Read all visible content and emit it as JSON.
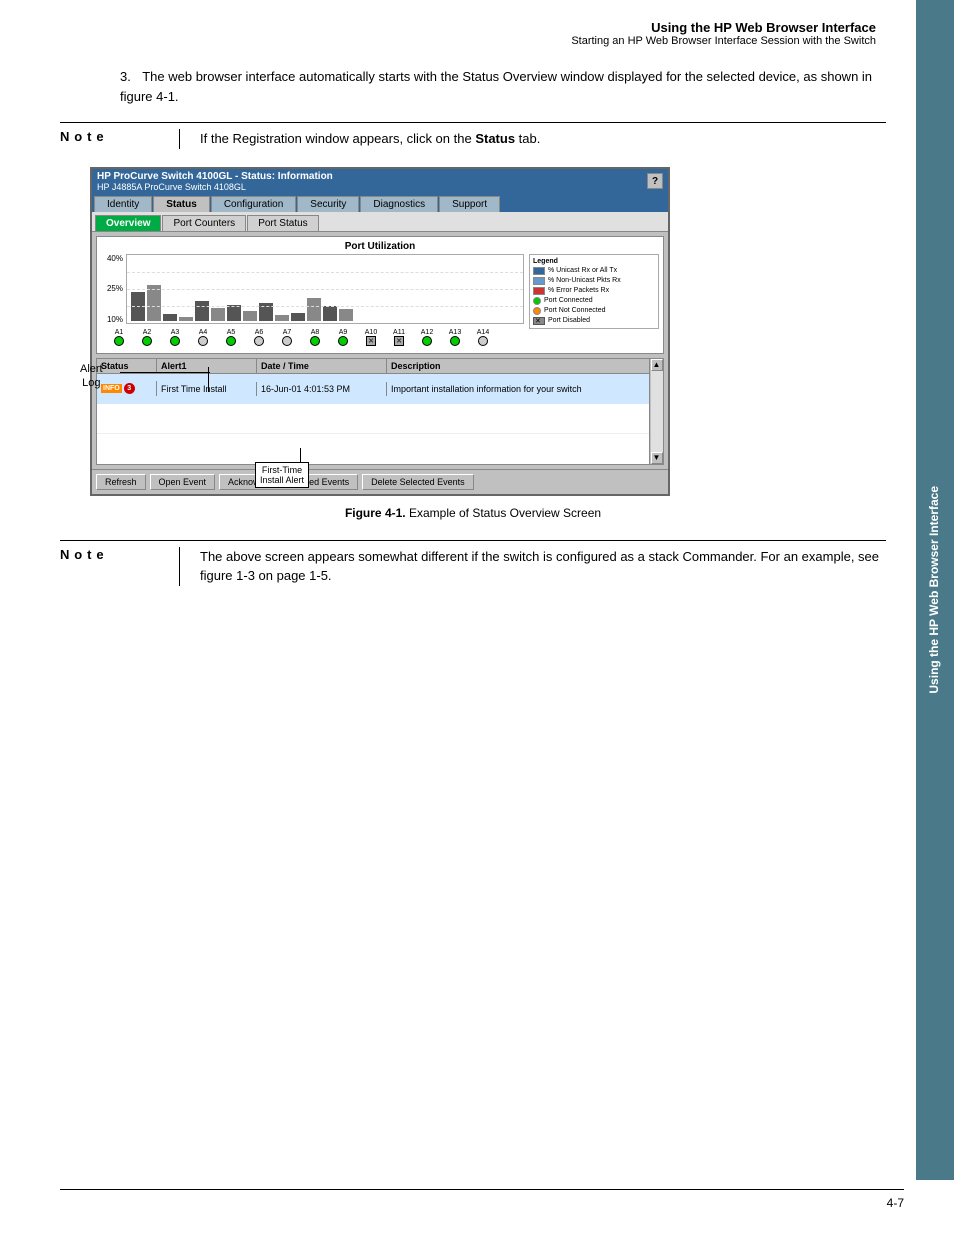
{
  "page": {
    "header": {
      "title": "Using the HP Web Browser Interface",
      "subtitle": "Starting an HP Web Browser Interface Session with the Switch"
    },
    "sidebar": {
      "text": "Using the HP Web Browser Interface"
    },
    "step3": {
      "number": "3.",
      "text": "The web browser interface automatically starts with the Status Overview window displayed for the selected device, as shown in figure 4-1."
    },
    "note1": {
      "label": "N o t e",
      "text_before": "If the Registration window appears, click on the ",
      "bold_text": "Status",
      "text_after": " tab."
    },
    "switch_ui": {
      "titlebar": {
        "title": "HP ProCurve Switch 4100GL - Status: Information",
        "subtitle": "HP J4885A ProCurve Switch 4108GL",
        "help_label": "?"
      },
      "nav_tabs": [
        {
          "label": "Identity",
          "active": false
        },
        {
          "label": "Status",
          "active": true
        },
        {
          "label": "Configuration",
          "active": false
        },
        {
          "label": "Security",
          "active": false
        },
        {
          "label": "Diagnostics",
          "active": false
        },
        {
          "label": "Support",
          "active": false
        }
      ],
      "subnav_tabs": [
        {
          "label": "Overview",
          "active": true
        },
        {
          "label": "Port Counters",
          "active": false
        },
        {
          "label": "Port Status",
          "active": false
        }
      ],
      "chart": {
        "title": "Port Utilization",
        "y_labels": [
          "40%",
          "25%",
          "10%"
        ],
        "legend": [
          {
            "color": "#336699",
            "text": "% Unicast Rx or All Tx"
          },
          {
            "color": "#336699",
            "text": "% Non-Unicast Pkts Rx"
          },
          {
            "color": "#cc3333",
            "text": "% Error Packets Rx"
          },
          {
            "type": "dot",
            "color": "#00cc00",
            "text": "Port Connected"
          },
          {
            "type": "dot",
            "color": "#ff8800",
            "text": "Port Not Connected"
          },
          {
            "type": "cross",
            "text": "Port Disabled"
          }
        ]
      },
      "ports": [
        {
          "label": "A1",
          "status": "green"
        },
        {
          "label": "A2",
          "status": "green"
        },
        {
          "label": "A3",
          "status": "green"
        },
        {
          "label": "A4",
          "status": "gray"
        },
        {
          "label": "A5",
          "status": "green"
        },
        {
          "label": "A6",
          "status": "gray"
        },
        {
          "label": "A7",
          "status": "gray"
        },
        {
          "label": "A8",
          "status": "green"
        },
        {
          "label": "A9",
          "status": "green"
        },
        {
          "label": "A10",
          "status": "crossed"
        },
        {
          "label": "A11",
          "status": "crossed"
        },
        {
          "label": "A12",
          "status": "green"
        },
        {
          "label": "A13",
          "status": "green"
        },
        {
          "label": "A14",
          "status": "gray"
        }
      ],
      "alert_table": {
        "headers": [
          "Status",
          "Alert1",
          "Date / Time",
          "Description"
        ],
        "row": {
          "status_badge": "INFO",
          "status_num": "3",
          "alert": "First Time Install",
          "datetime": "16-Jun-01 4:01:53 PM",
          "description": "Important installation information for your switch"
        }
      },
      "buttons": [
        {
          "label": "Refresh"
        },
        {
          "label": "Open Event"
        },
        {
          "label": "Acknowledge Selected Events"
        },
        {
          "label": "Delete Selected Events"
        }
      ]
    },
    "figure_caption": {
      "label": "Figure 4-1.",
      "text": "Example of Status Overview Screen"
    },
    "note2": {
      "label": "N o t e",
      "text": "The above screen appears somewhat different if the switch is configured as a stack Commander. For an example, see figure 1-3 on page 1-5."
    },
    "alert_log_label": "Alert\nLog",
    "first_time_label_line1": "First-Time",
    "first_time_label_line2": "Install Alert",
    "page_number": "4-7"
  }
}
